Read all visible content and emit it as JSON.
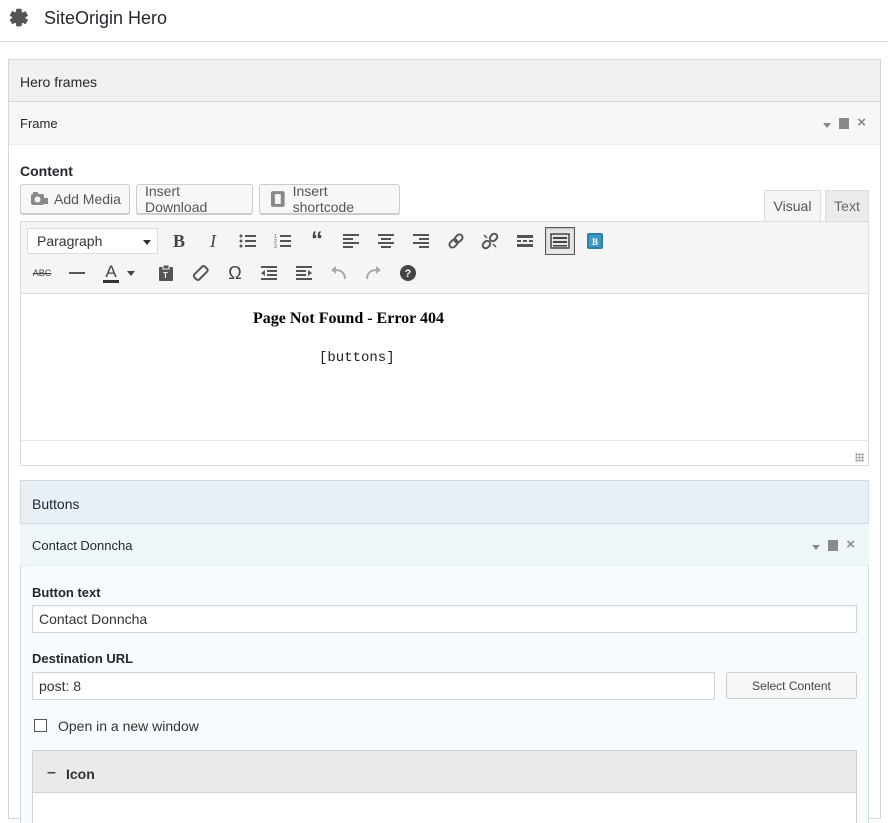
{
  "app": {
    "title": "SiteOrigin Hero",
    "icon": "gear-icon"
  },
  "hero_frames": {
    "label": "Hero frames"
  },
  "frame": {
    "label": "Frame"
  },
  "content": {
    "label": "Content",
    "add_media_label": "Add Media",
    "insert_download_label": "Insert Download",
    "insert_shortcode_label": "Insert shortcode",
    "tabs": {
      "visual": "Visual",
      "text": "Text"
    },
    "format_select_value": "Paragraph",
    "toolbar_row1": [
      "bold-icon",
      "italic-icon",
      "bullet-list-icon",
      "numbered-list-icon",
      "blockquote-icon",
      "align-left-icon",
      "align-center-icon",
      "align-right-icon",
      "link-icon",
      "unlink-icon",
      "read-more-icon",
      "toolbar-toggle-icon",
      "bootstrap-icon"
    ],
    "toolbar_row2": [
      "strikethrough-icon",
      "horizontal-line-icon",
      "text-color-icon",
      "paste-text-icon",
      "clear-formatting-icon",
      "special-character-icon",
      "outdent-icon",
      "indent-icon",
      "undo-icon",
      "redo-icon",
      "help-icon"
    ],
    "heading_text": "Page Not Found - Error 404",
    "shortcode_text": "[buttons]"
  },
  "buttons": {
    "label": "Buttons",
    "item": {
      "label": "Contact Donncha",
      "button_text_label": "Button text",
      "button_text_value": "Contact Donncha",
      "destination_url_label": "Destination URL",
      "destination_url_value": "post: 8",
      "select_content_label": "Select Content",
      "new_window_label": "Open in a new window",
      "new_window_checked": false,
      "icon_section": {
        "toggle": "–",
        "label": "Icon"
      }
    }
  },
  "colors": {
    "accent_blue": "#2e7ea8",
    "section_blue_bg": "#e8f0f5"
  }
}
